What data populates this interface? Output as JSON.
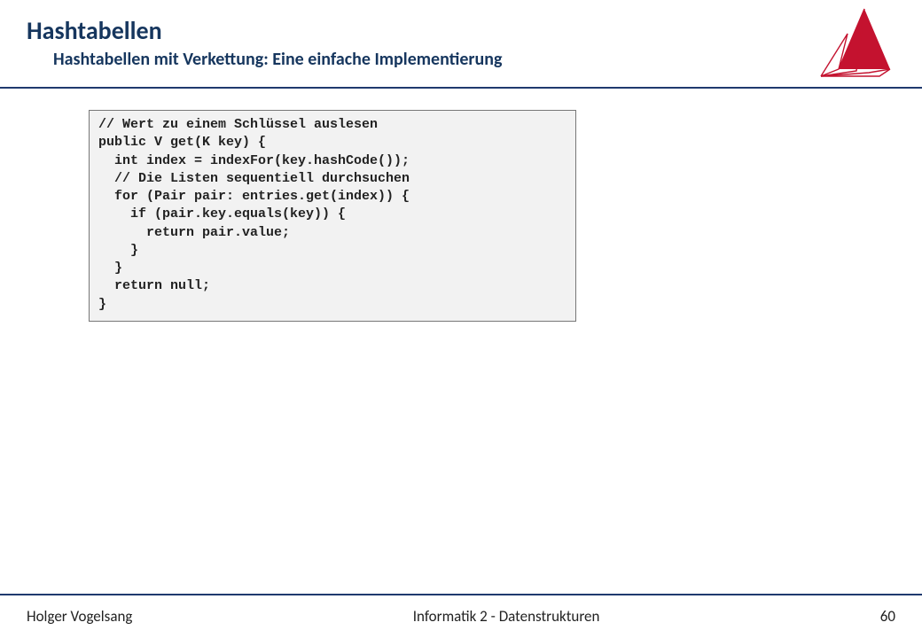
{
  "header": {
    "title": "Hashtabellen",
    "subtitle": "Hashtabellen mit Verkettung: Eine einfache Implementierung"
  },
  "code": "// Wert zu einem Schlüssel auslesen\npublic V get(K key) {\n  int index = indexFor(key.hashCode());\n  // Die Listen sequentiell durchsuchen\n  for (Pair pair: entries.get(index)) {\n    if (pair.key.equals(key)) {\n      return pair.value;\n    }\n  }\n  return null;\n}",
  "footer": {
    "author": "Holger Vogelsang",
    "course": "Informatik 2 - Datenstrukturen",
    "page": "60"
  }
}
